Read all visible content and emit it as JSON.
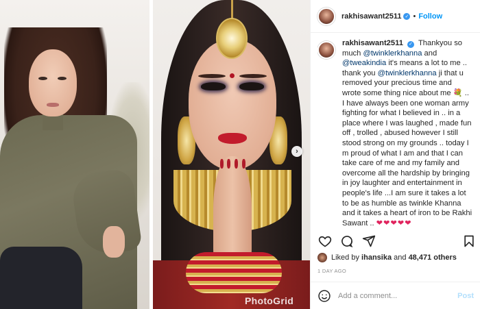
{
  "media": {
    "watermark": "PhotoGrid",
    "next_icon": "chevron-right-icon"
  },
  "header": {
    "username": "rakhisawant2511",
    "separator": "•",
    "follow_label": "Follow",
    "verified_icon": "verified-badge-icon"
  },
  "caption": {
    "username": "rakhisawant2511",
    "t1": "Thankyou so much ",
    "m1": "@twinklerkhanna",
    "t2": " and ",
    "m2": "@tweakindia",
    "t3": " it's means a lot to me .. thank you ",
    "m3": "@twinklerkhanna",
    "t4": " ji that u removed your precious time and wrote some thing nice about me ",
    "emoji": "💐",
    "t5": " .. I have always been one woman army fighting for what I believed in .. in a place where I was laughed , made fun off , trolled , abused however I still stood strong on my grounds .. today I m proud of what I am and that I can take care of me and my family and overcome all the hardship by bringing in joy laughter and entertainment in people's life ...I am sure it takes a lot to be as humble as twinkle Khanna and it takes a heart of iron to be Rakhi Sawant ..",
    "hearts": "❤❤❤❤❤"
  },
  "actions": {
    "like_icon": "heart-icon",
    "comment_icon": "comment-icon",
    "share_icon": "share-icon",
    "save_icon": "bookmark-icon"
  },
  "likes": {
    "prefix": "Liked by ",
    "user": "ihansika",
    "middle": " and ",
    "count": "48,471 others"
  },
  "time_ago": "1 DAY AGO",
  "comment_box": {
    "placeholder": "Add a comment...",
    "post_label": "Post",
    "emoji_icon": "smiley-icon"
  },
  "colors": {
    "accent": "#0095f6",
    "verified": "#3897f0",
    "text": "#262626",
    "muted": "#8e8e8e",
    "heart": "#e0245e"
  }
}
